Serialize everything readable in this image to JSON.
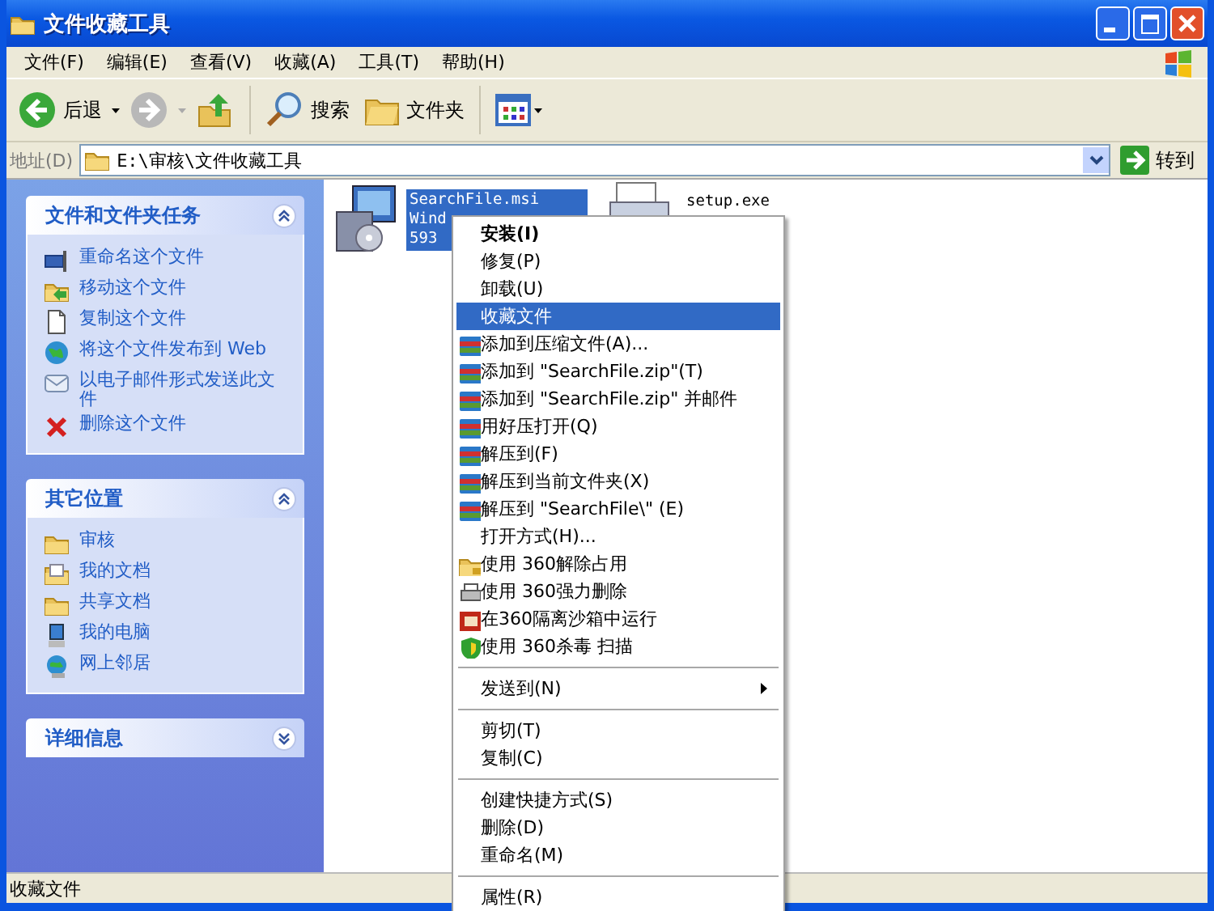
{
  "window": {
    "title": "文件收藏工具"
  },
  "menu_bar": [
    "文件(F)",
    "编辑(E)",
    "查看(V)",
    "收藏(A)",
    "工具(T)",
    "帮助(H)"
  ],
  "toolbar": {
    "back": "后退",
    "search": "搜索",
    "folders": "文件夹"
  },
  "address_bar": {
    "label": "地址(D)",
    "value": "E:\\审核\\文件收藏工具",
    "go": "转到"
  },
  "task_panes": [
    {
      "title": "文件和文件夹任务",
      "expanded": true,
      "items": [
        {
          "kind": "rename",
          "label": "重命名这个文件"
        },
        {
          "kind": "move",
          "label": "移动这个文件"
        },
        {
          "kind": "copy",
          "label": "复制这个文件"
        },
        {
          "kind": "web",
          "label": "将这个文件发布到 Web"
        },
        {
          "kind": "email",
          "label": "以电子邮件形式发送此文件"
        },
        {
          "kind": "delete",
          "label": "删除这个文件"
        }
      ]
    },
    {
      "title": "其它位置",
      "expanded": true,
      "items": [
        {
          "kind": "folder",
          "label": "审核"
        },
        {
          "kind": "documents",
          "label": "我的文档"
        },
        {
          "kind": "folder",
          "label": "共享文档"
        },
        {
          "kind": "computer",
          "label": "我的电脑"
        },
        {
          "kind": "network",
          "label": "网上邻居"
        }
      ]
    },
    {
      "title": "详细信息",
      "expanded": false
    }
  ],
  "files": [
    {
      "kind": "installer",
      "name": "SearchFile.msi",
      "details": [
        "Wind",
        "593"
      ],
      "selected": true
    },
    {
      "kind": "printer",
      "name": "setup.exe",
      "selected": false
    }
  ],
  "context_menu": [
    {
      "kind": "item",
      "label": "安装(I)",
      "default": true,
      "selected": false
    },
    {
      "kind": "item",
      "label": "修复(P)",
      "default": false,
      "selected": false
    },
    {
      "kind": "item",
      "label": "卸载(U)",
      "default": false,
      "selected": false
    },
    {
      "kind": "item",
      "label": "收藏文件",
      "default": false,
      "selected": true
    },
    {
      "kind": "archive",
      "label": "添加到压缩文件(A)...",
      "default": false,
      "selected": false
    },
    {
      "kind": "archive",
      "label": "添加到 \"SearchFile.zip\"(T)",
      "default": false,
      "selected": false
    },
    {
      "kind": "archive",
      "label": "添加到 \"SearchFile.zip\" 并邮件",
      "default": false,
      "selected": false
    },
    {
      "kind": "archive",
      "label": "用好压打开(Q)",
      "default": false,
      "selected": false
    },
    {
      "kind": "archive",
      "label": "解压到(F)",
      "default": false,
      "selected": false
    },
    {
      "kind": "archive",
      "label": "解压到当前文件夹(X)",
      "default": false,
      "selected": false
    },
    {
      "kind": "archive",
      "label": "解压到 \"SearchFile\\\" (E)",
      "default": false,
      "selected": false
    },
    {
      "kind": "item",
      "label": "打开方式(H)...",
      "default": false,
      "selected": false
    },
    {
      "kind": "unlock",
      "label": "使用 360解除占用",
      "default": false,
      "selected": false
    },
    {
      "kind": "shredder",
      "label": "使用 360强力删除",
      "default": false,
      "selected": false
    },
    {
      "kind": "sandbox",
      "label": "在360隔离沙箱中运行",
      "default": false,
      "selected": false
    },
    {
      "kind": "shield",
      "label": "使用 360杀毒 扫描",
      "default": false,
      "selected": false
    },
    {
      "kind": "separator"
    },
    {
      "kind": "submenu",
      "label": "发送到(N)",
      "default": false,
      "selected": false
    },
    {
      "kind": "separator"
    },
    {
      "kind": "item",
      "label": "剪切(T)",
      "default": false,
      "selected": false
    },
    {
      "kind": "item",
      "label": "复制(C)",
      "default": false,
      "selected": false
    },
    {
      "kind": "separator"
    },
    {
      "kind": "item",
      "label": "创建快捷方式(S)",
      "default": false,
      "selected": false
    },
    {
      "kind": "item",
      "label": "删除(D)",
      "default": false,
      "selected": false
    },
    {
      "kind": "item",
      "label": "重命名(M)",
      "default": false,
      "selected": false
    },
    {
      "kind": "separator"
    },
    {
      "kind": "item",
      "label": "属性(R)",
      "default": false,
      "selected": false
    }
  ],
  "status_bar": "收藏文件"
}
